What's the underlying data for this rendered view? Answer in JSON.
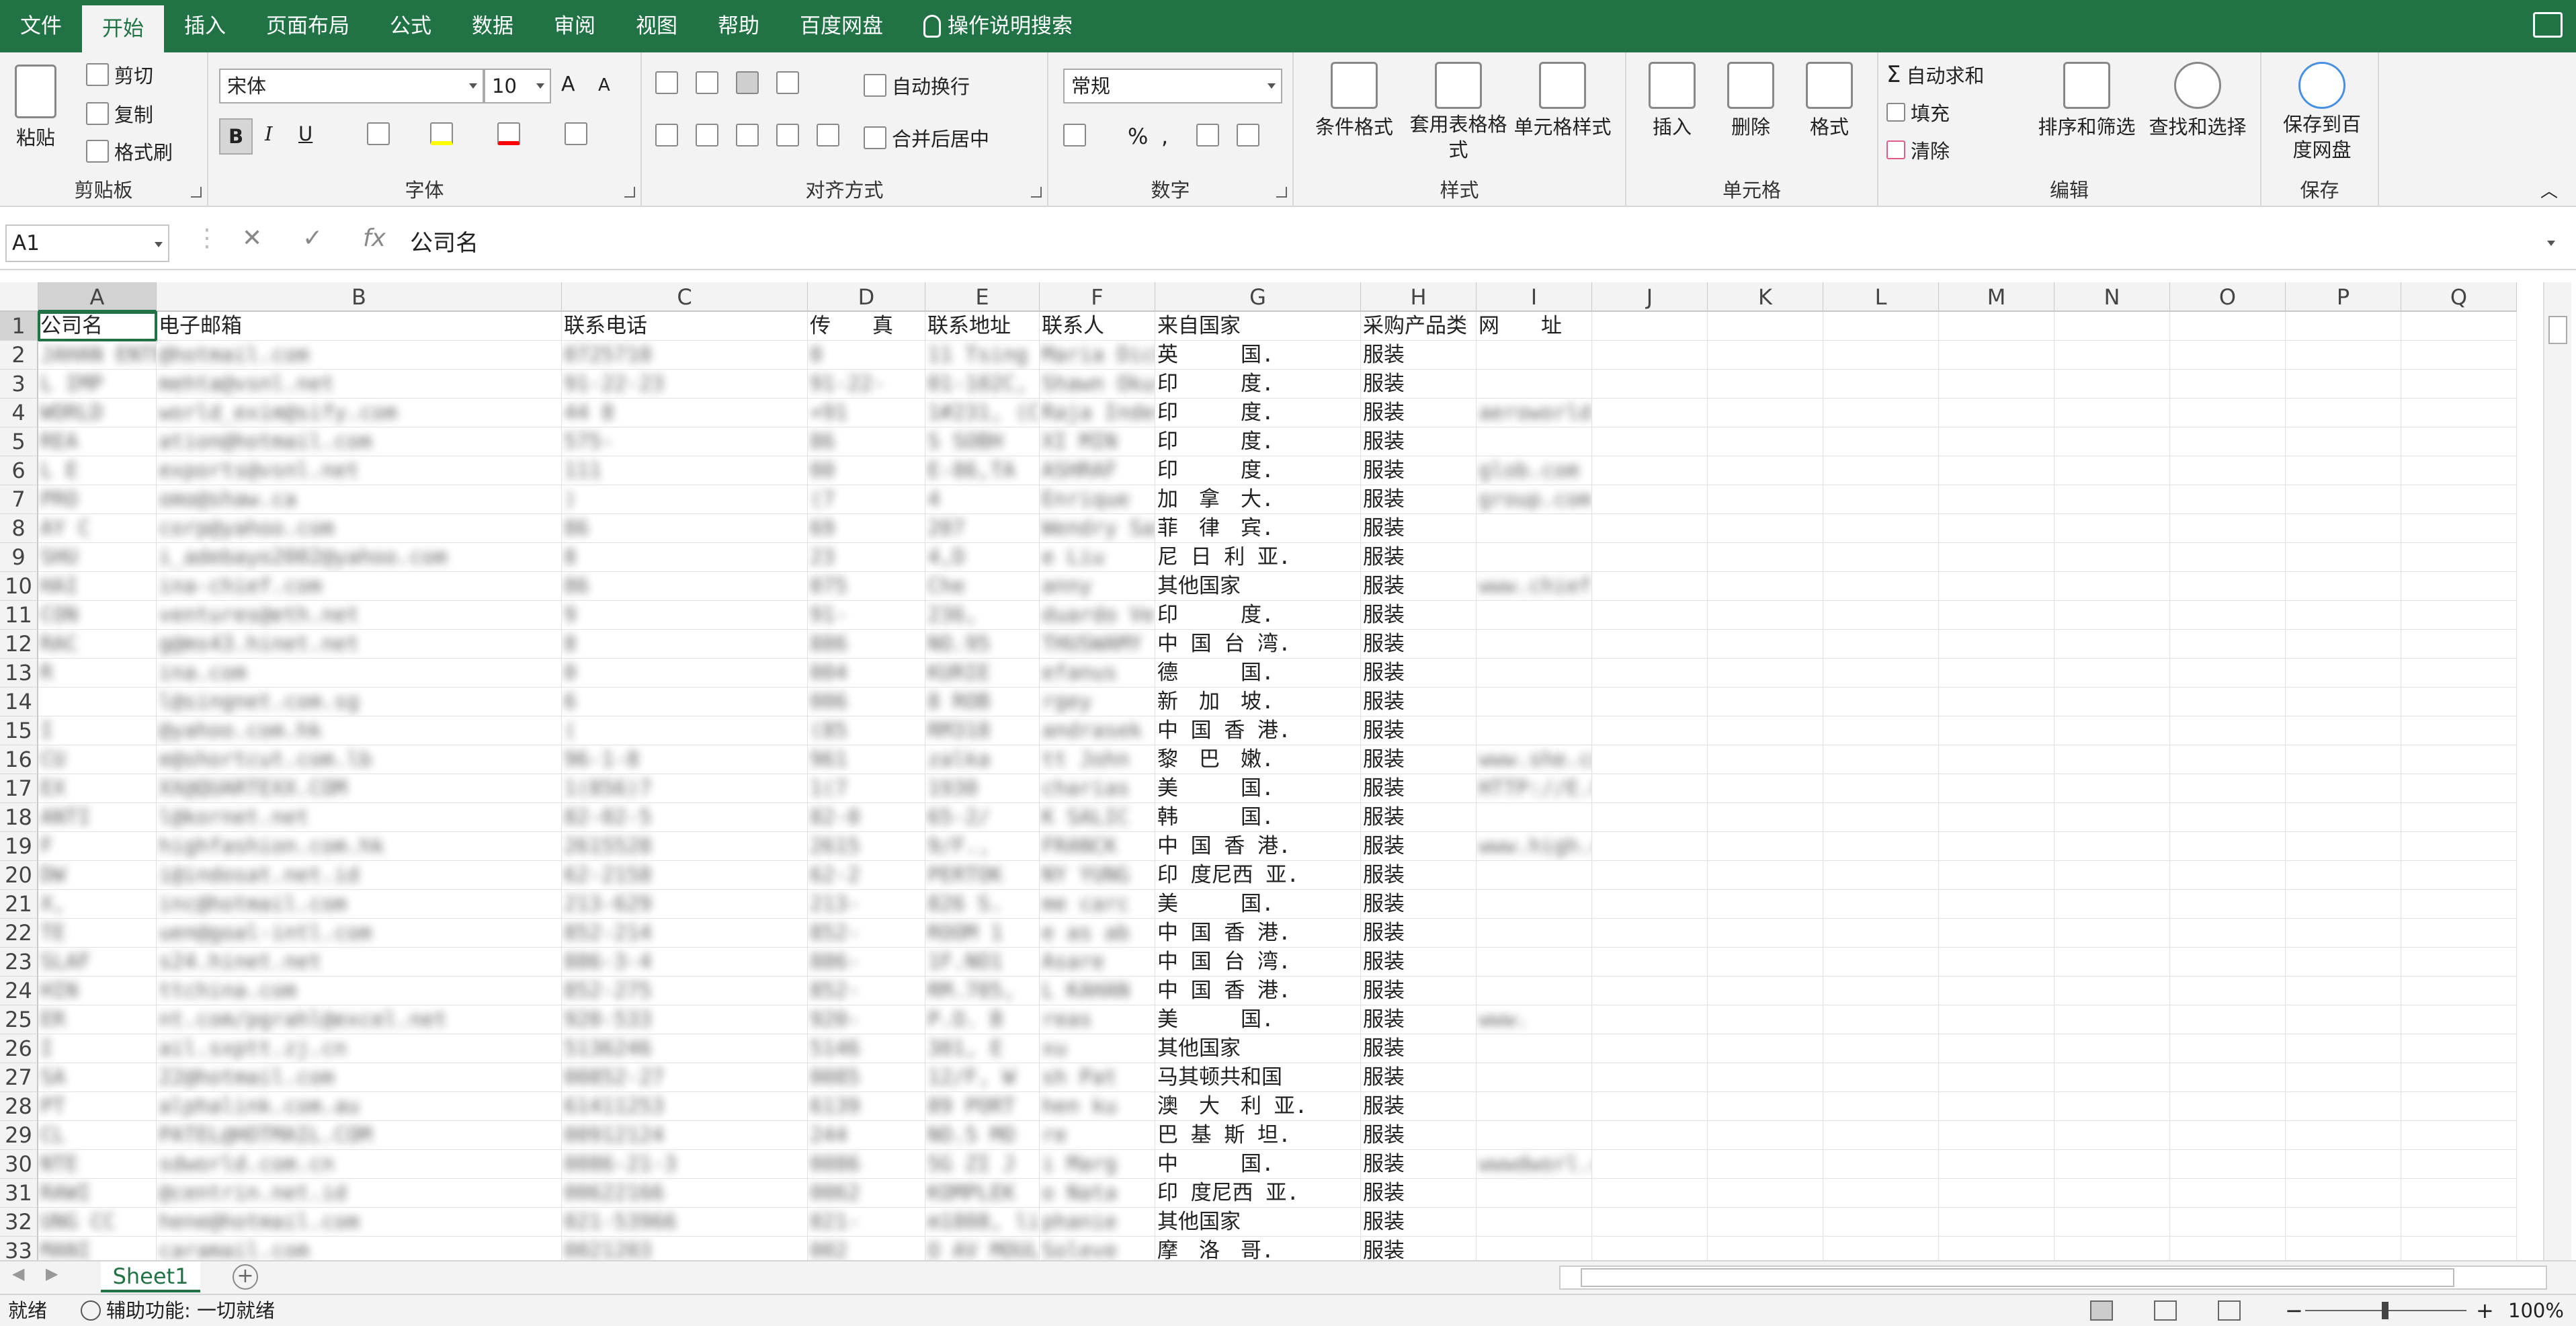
{
  "tabs": [
    "文件",
    "开始",
    "插入",
    "页面布局",
    "公式",
    "数据",
    "审阅",
    "视图",
    "帮助",
    "百度网盘"
  ],
  "tell_me": "操作说明搜索",
  "ribbon": {
    "clipboard": {
      "paste": "粘贴",
      "cut": "剪切",
      "copy": "复制",
      "format_painter": "格式刷",
      "label": "剪贴板"
    },
    "font": {
      "name": "宋体",
      "size": "10",
      "bold": "B",
      "italic": "I",
      "underline": "U",
      "label": "字体"
    },
    "alignment": {
      "wrap": "自动换行",
      "merge": "合并后居中",
      "label": "对齐方式"
    },
    "number": {
      "format": "常规",
      "label": "数字"
    },
    "styles": {
      "conditional": "条件格式",
      "table": "套用表格格式",
      "cell_styles": "单元格样式",
      "label": "样式"
    },
    "cells": {
      "insert": "插入",
      "delete": "删除",
      "format": "格式",
      "label": "单元格"
    },
    "editing": {
      "autosum": "自动求和",
      "fill": "填充",
      "clear": "清除",
      "sort": "排序和筛选",
      "find": "查找和选择",
      "label": "编辑"
    },
    "save": {
      "button": "保存到百度网盘",
      "label": "保存"
    }
  },
  "formula_bar": {
    "name_box": "A1",
    "fx": "fx",
    "content": "公司名"
  },
  "columns": [
    "A",
    "B",
    "C",
    "D",
    "E",
    "F",
    "G",
    "H",
    "I",
    "J",
    "K",
    "L",
    "M",
    "N",
    "O",
    "P",
    "Q"
  ],
  "rows": [
    {
      "n": "1",
      "A": "公司名",
      "B": "电子邮箱",
      "C": "联系电话",
      "D": "传　　真",
      "E": "联系地址",
      "F": "联系人",
      "G": "来自国家",
      "H": "采购产品类",
      "I": "网　　址"
    },
    {
      "n": "2",
      "A": "JAHAN ENTE",
      "B": "@hotmail.com",
      "C": "0725710",
      "D": "0",
      "E": "11 Tsing",
      "F": "Maria Dick",
      "G": "英　　　国.",
      "H": "服装",
      "I": ""
    },
    {
      "n": "3",
      "A": "L IMP",
      "B": "mehta@vsnl.net",
      "C": "91-22-23",
      "D": "91-22-",
      "E": "01-102C,",
      "F": "Shawn Okur",
      "G": "印　　　度.",
      "H": "服装",
      "I": ""
    },
    {
      "n": "4",
      "A": "WORLD",
      "B": "world_exim@sify.com",
      "C": "44 8",
      "D": "+91",
      "E": "1#231, (C",
      "F": "Raja Inder",
      "G": "印　　　度.",
      "H": "服装",
      "I": "aeroworld-travels.com"
    },
    {
      "n": "5",
      "A": "REA",
      "B": "ation@hotmail.com",
      "C": "575-",
      "D": "86",
      "E": "S SOBH",
      "F": "XI MIN",
      "G": "印　　　度.",
      "H": "服装",
      "I": ""
    },
    {
      "n": "6",
      "A": "L E",
      "B": "exports@vsnl.net",
      "C": "111",
      "D": "00",
      "E": "E-86,TA",
      "F": "ASHRAF",
      "G": "印　　　度.",
      "H": "服装",
      "I": "glob.com"
    },
    {
      "n": "7",
      "A": "PRO",
      "B": "omo@shaw.ca",
      "C": ")",
      "D": "(7",
      "E": "4",
      "F": "Enrique",
      "G": "加　拿　大.",
      "H": "服装",
      "I": "group.com"
    },
    {
      "n": "8",
      "A": "AY C",
      "B": "corp@yahoo.com",
      "C": "86",
      "D": "69",
      "E": "207",
      "F": "Wendry Sai",
      "G": "菲　律　宾.",
      "H": "服装",
      "I": ""
    },
    {
      "n": "9",
      "A": "SHU",
      "B": "i_adebayo2002@yahoo.com",
      "C": "8",
      "D": "23",
      "E": "4,D",
      "F": "e Liu",
      "G": "尼 日 利 亚.",
      "H": "服装",
      "I": ""
    },
    {
      "n": "10",
      "A": "HAI",
      "B": "ina-chief.com",
      "C": "86",
      "D": "075",
      "E": "Che",
      "F": "anny",
      "G": "其他国家",
      "H": "服装",
      "I": "www.chief.com"
    },
    {
      "n": "11",
      "A": "CON",
      "B": "ventures@eth.net",
      "C": "9",
      "D": "91-",
      "E": "236,",
      "F": "duardo Ve",
      "G": "印　　　度.",
      "H": "服装",
      "I": ""
    },
    {
      "n": "12",
      "A": "RAC",
      "B": "g@ms43.hinet.net",
      "C": "8",
      "D": "886",
      "E": "NO.95",
      "F": "THUSWAMY",
      "G": "中 国 台 湾.",
      "H": "服装",
      "I": ""
    },
    {
      "n": "13",
      "A": "R",
      "B": "ina.com",
      "C": "0",
      "D": "004",
      "E": "KURIE",
      "F": "efanus",
      "G": "德　　　国.",
      "H": "服装",
      "I": ""
    },
    {
      "n": "14",
      "A": "",
      "B": "l@singnet.com.sg",
      "C": "6",
      "D": "006",
      "E": "8 ROB",
      "F": "rgey",
      "G": "新　加　坡.",
      "H": "服装",
      "I": ""
    },
    {
      "n": "15",
      "A": "I",
      "B": "@yahoo.com.hk",
      "C": "(",
      "D": "(85",
      "E": "RM318",
      "F": "andrasek",
      "G": "中 国 香 港.",
      "H": "服装",
      "I": ""
    },
    {
      "n": "16",
      "A": "CU",
      "B": "e@shortcut.com.lb",
      "C": "96-1-8",
      "D": "961",
      "E": "zalka",
      "F": "tt John",
      "G": "黎　巴　嫩.",
      "H": "服装",
      "I": "www.she.com."
    },
    {
      "n": "17",
      "A": "EX",
      "B": "XX@QUARTEXX.COM",
      "C": "1(856)7",
      "D": "1(7",
      "E": "1930",
      "F": "charias",
      "G": "美　　　国.",
      "H": "服装",
      "I": "HTTP://E.COM"
    },
    {
      "n": "18",
      "A": "ANTI",
      "B": "l@kornet.net",
      "C": "82-02-5",
      "D": "82-0",
      "E": "65-2/",
      "F": "K SALIC",
      "G": "韩　　　国.",
      "H": "服装",
      "I": ""
    },
    {
      "n": "19",
      "A": "F",
      "B": "highfashion.com.hk",
      "C": "2615528",
      "D": "2615",
      "E": "9/F.,",
      "F": "FRANCK",
      "G": "中 国 香 港.",
      "H": "服装",
      "I": "www.high.com.hk"
    },
    {
      "n": "20",
      "A": "DW",
      "B": "i@indosat.net.id",
      "C": "62-2158",
      "D": "62-2",
      "E": "PERTOK",
      "F": "NY YUNG",
      "G": "印 度尼西 亚.",
      "H": "服装",
      "I": ""
    },
    {
      "n": "21",
      "A": "X,",
      "B": "inc@hotmail.com",
      "C": "213-629",
      "D": "213-",
      "E": "826 S.",
      "F": "me carc",
      "G": "美　　　国.",
      "H": "服装",
      "I": ""
    },
    {
      "n": "22",
      "A": "TE",
      "B": "uen@goal-intl.com",
      "C": "852-214",
      "D": "852-",
      "E": "ROOM 1",
      "F": "e as ab",
      "G": "中 国 香 港.",
      "H": "服装",
      "I": ""
    },
    {
      "n": "23",
      "A": "SLAF",
      "B": "s24.hinet.net",
      "C": "886-3-4",
      "D": "886-",
      "E": "1F.NO1",
      "F": "Asare",
      "G": "中 国 台 湾.",
      "H": "服装",
      "I": ""
    },
    {
      "n": "24",
      "A": "HIN",
      "B": "ttchina.com",
      "C": "852-275",
      "D": "852-",
      "E": "RM.705,",
      "F": "L KAHAN",
      "G": "中 国 香 港.",
      "H": "服装",
      "I": ""
    },
    {
      "n": "25",
      "A": "ER",
      "B": "nt.com/pgrahl@excel.net",
      "C": "920-533",
      "D": "920-",
      "E": "P.O. B",
      "F": "reas",
      "G": "美　　　国.",
      "H": "服装",
      "I": "www."
    },
    {
      "n": "26",
      "A": "I",
      "B": "ail.sxptt.zj.cn",
      "C": "5136246",
      "D": "5146",
      "E": "301, E",
      "F": "xu",
      "G": "其他国家",
      "H": "服装",
      "I": ""
    },
    {
      "n": "27",
      "A": "SA",
      "B": "22@hotmail.com",
      "C": "00852-27",
      "D": "0085",
      "E": "12/F, W",
      "F": "sh Pat",
      "G": "马其顿共和国",
      "H": "服装",
      "I": ""
    },
    {
      "n": "28",
      "A": "PT",
      "B": "alphalink.com.au",
      "C": "61411253",
      "D": "6139",
      "E": "89 PORT",
      "F": "hen ku",
      "G": "澳　大　利 亚.",
      "H": "服装",
      "I": ""
    },
    {
      "n": "29",
      "A": "CL",
      "B": "PATEL@HOTMAIL.COM",
      "C": "00912124",
      "D": "244",
      "E": "NO.5 MO",
      "F": "re",
      "G": "巴 基 斯 坦.",
      "H": "服装",
      "I": ""
    },
    {
      "n": "30",
      "A": "NTE",
      "B": "sdworld.com.cn",
      "C": "0086-21-3",
      "D": "0086",
      "E": "5G ZI J",
      "F": "i Marg",
      "G": "中　　　国.",
      "H": "服装",
      "I": "wwwdworl.cn"
    },
    {
      "n": "31",
      "A": "RAWI",
      "B": "@centrin.net.id",
      "C": "00622166",
      "D": "0062",
      "E": "KOMPLEK",
      "F": "o Nata",
      "G": "印 度尼西 亚.",
      "H": "服装",
      "I": ""
    },
    {
      "n": "32",
      "A": "UNG CC",
      "B": "hene@hotmail.com",
      "C": "021-53966",
      "D": "021-",
      "E": "m1808, li",
      "F": "phanie",
      "G": "其他国家",
      "H": "服装",
      "I": ""
    },
    {
      "n": "33",
      "A": "MANI",
      "B": "caramail.com",
      "C": "0021203",
      "D": "002",
      "E": "O AV MOUL",
      "F": "Soleve",
      "G": "摩　洛　哥.",
      "H": "服装",
      "I": ""
    }
  ],
  "sheet_tab": "Sheet1",
  "status": {
    "ready": "就绪",
    "accessibility": "辅助功能: 一切就绪",
    "zoom": "100%"
  }
}
